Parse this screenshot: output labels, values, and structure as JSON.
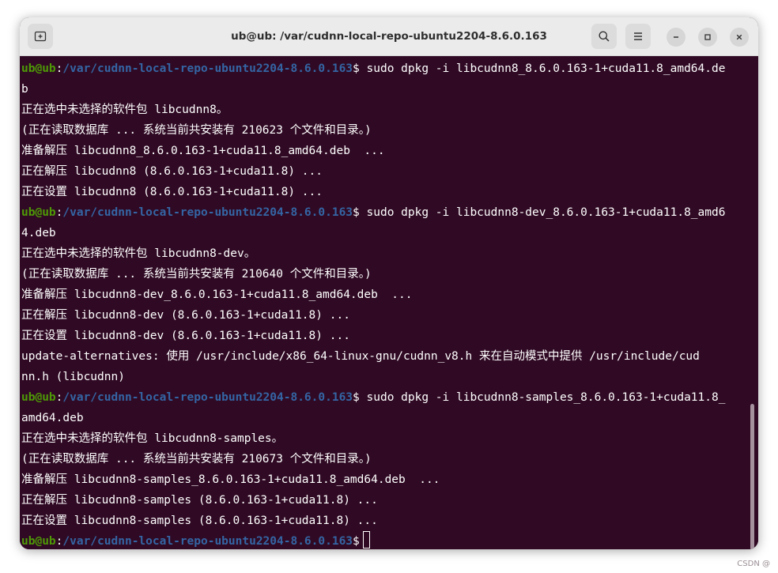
{
  "window": {
    "title": "ub@ub: /var/cudnn-local-repo-ubuntu2204-8.6.0.163",
    "new_tab_icon": "new-tab-icon",
    "search_icon": "search-icon",
    "menu_icon": "hamburger-menu-icon"
  },
  "prompt": {
    "user": "ub@ub",
    "colon": ":",
    "path": "/var/cudnn-local-repo-ubuntu2204-8.6.0.163",
    "symbol": "$"
  },
  "lines": [
    {
      "type": "prompt",
      "cmd": " sudo dpkg -i libcudnn8_8.6.0.163-1+cuda11.8_amd64.de"
    },
    {
      "type": "text",
      "text": "b"
    },
    {
      "type": "text",
      "text": "正在选中未选择的软件包 libcudnn8。"
    },
    {
      "type": "text",
      "text": "(正在读取数据库 ... 系统当前共安装有 210623 个文件和目录。)"
    },
    {
      "type": "text",
      "text": "准备解压 libcudnn8_8.6.0.163-1+cuda11.8_amd64.deb  ..."
    },
    {
      "type": "text",
      "text": "正在解压 libcudnn8 (8.6.0.163-1+cuda11.8) ..."
    },
    {
      "type": "text",
      "text": "正在设置 libcudnn8 (8.6.0.163-1+cuda11.8) ..."
    },
    {
      "type": "prompt",
      "cmd": " sudo dpkg -i libcudnn8-dev_8.6.0.163-1+cuda11.8_amd6"
    },
    {
      "type": "text",
      "text": "4.deb"
    },
    {
      "type": "text",
      "text": "正在选中未选择的软件包 libcudnn8-dev。"
    },
    {
      "type": "text",
      "text": "(正在读取数据库 ... 系统当前共安装有 210640 个文件和目录。)"
    },
    {
      "type": "text",
      "text": "准备解压 libcudnn8-dev_8.6.0.163-1+cuda11.8_amd64.deb  ..."
    },
    {
      "type": "text",
      "text": "正在解压 libcudnn8-dev (8.6.0.163-1+cuda11.8) ..."
    },
    {
      "type": "text",
      "text": "正在设置 libcudnn8-dev (8.6.0.163-1+cuda11.8) ..."
    },
    {
      "type": "text",
      "text": "update-alternatives: 使用 /usr/include/x86_64-linux-gnu/cudnn_v8.h 来在自动模式中提供 /usr/include/cud"
    },
    {
      "type": "text",
      "text": "nn.h (libcudnn)"
    },
    {
      "type": "prompt",
      "cmd": " sudo dpkg -i libcudnn8-samples_8.6.0.163-1+cuda11.8_"
    },
    {
      "type": "text",
      "text": "amd64.deb"
    },
    {
      "type": "text",
      "text": "正在选中未选择的软件包 libcudnn8-samples。"
    },
    {
      "type": "text",
      "text": "(正在读取数据库 ... 系统当前共安装有 210673 个文件和目录。)"
    },
    {
      "type": "text",
      "text": "准备解压 libcudnn8-samples_8.6.0.163-1+cuda11.8_amd64.deb  ..."
    },
    {
      "type": "text",
      "text": "正在解压 libcudnn8-samples (8.6.0.163-1+cuda11.8) ..."
    },
    {
      "type": "text",
      "text": "正在设置 libcudnn8-samples (8.6.0.163-1+cuda11.8) ..."
    },
    {
      "type": "prompt",
      "cmd": " ",
      "cursor": true
    }
  ],
  "watermark": "CSDN @"
}
